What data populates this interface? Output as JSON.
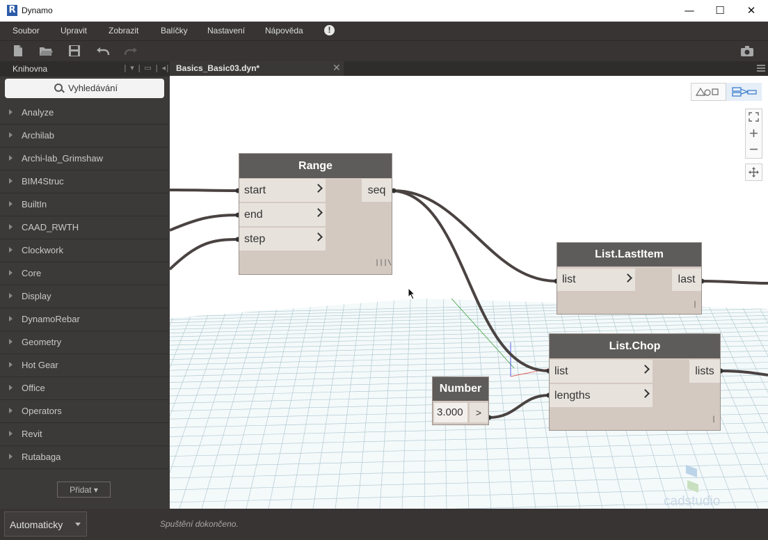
{
  "window": {
    "title": "Dynamo",
    "logo_letter": "R",
    "minimize": "—",
    "maximize": "☐",
    "close": "✕"
  },
  "menu": {
    "items": [
      "Soubor",
      "Upravit",
      "Zobrazit",
      "Balíčky",
      "Nastavení",
      "Nápověda"
    ],
    "alert": "!"
  },
  "toolbar": {
    "icons": [
      "new-file-icon",
      "open-folder-icon",
      "save-icon",
      "undo-icon",
      "redo-icon",
      "camera-icon"
    ]
  },
  "library": {
    "title": "Knihovna",
    "tools": "| ▾ | ▭ | ◂|",
    "search_placeholder": "Vyhledávání",
    "categories": [
      "Analyze",
      "Archilab",
      "Archi-lab_Grimshaw",
      "BIM4Struc",
      "BuiltIn",
      "CAAD_RWTH",
      "Clockwork",
      "Core",
      "Display",
      "DynamoRebar",
      "Geometry",
      "Hot Gear",
      "Office",
      "Operators",
      "Revit",
      "Rutabaga"
    ],
    "add_button": "Přidat ▾"
  },
  "tabs": [
    {
      "label": "Basics_Basic03.dyn*",
      "close": "✕"
    }
  ],
  "nodes": {
    "range": {
      "title": "Range",
      "inputs": [
        "start",
        "end",
        "step"
      ],
      "output": "seq",
      "lacing": "|||\\"
    },
    "last_item": {
      "title": "List.LastItem",
      "inputs": [
        "list"
      ],
      "output": "last",
      "lacing": "|"
    },
    "chop": {
      "title": "List.Chop",
      "inputs": [
        "list",
        "lengths"
      ],
      "output": "lists",
      "lacing": "|"
    },
    "number": {
      "title": "Number",
      "value": "3.000",
      "arrow": ">"
    }
  },
  "bottom": {
    "run_mode": "Automaticky",
    "status": "Spuštění dokončeno."
  },
  "colors": {
    "chrome": "#383434",
    "library_bg": "#3c3a39",
    "node_header": "#5e5c5b",
    "node_body": "#d4c9c1",
    "wire": "#4a4342",
    "grid": "#a8c4cc"
  }
}
